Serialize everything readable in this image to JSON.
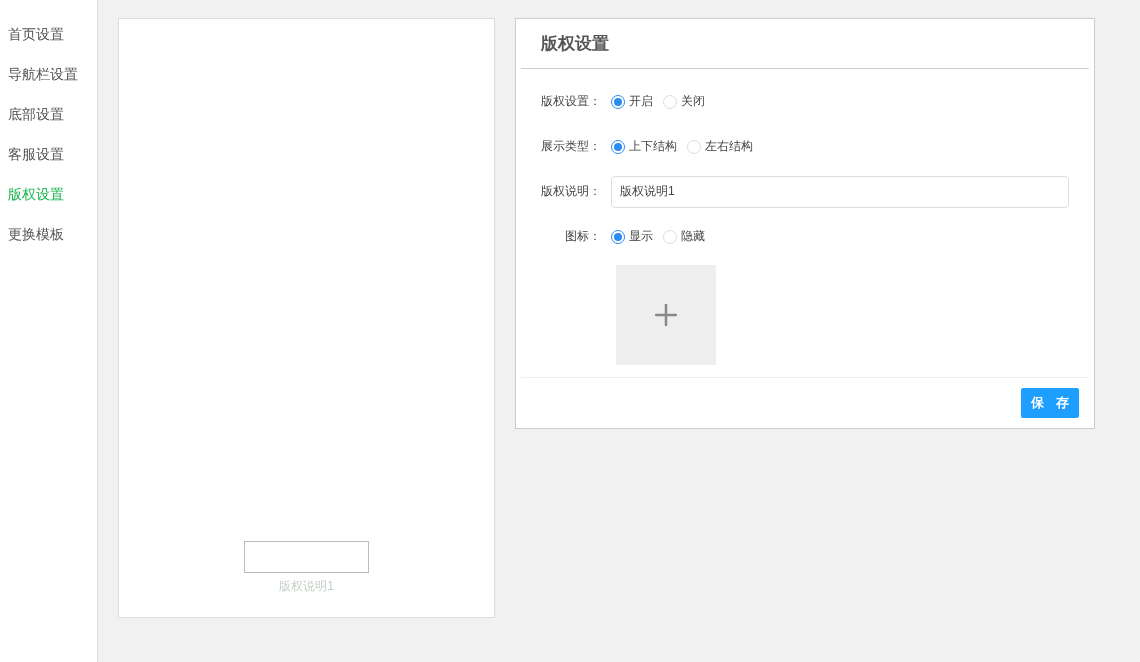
{
  "sidebar": {
    "items": [
      {
        "label": "首页设置",
        "selected": false
      },
      {
        "label": "导航栏设置",
        "selected": false
      },
      {
        "label": "底部设置",
        "selected": false
      },
      {
        "label": "客服设置",
        "selected": false
      },
      {
        "label": "版权设置",
        "selected": true
      },
      {
        "label": "更换模板",
        "selected": false
      }
    ]
  },
  "preview": {
    "caption": "版权说明1"
  },
  "panel": {
    "title": "版权设置",
    "fields": [
      {
        "kind": "radio",
        "label": "版权设置：",
        "options": [
          {
            "label": "开启",
            "selected": true
          },
          {
            "label": "关闭",
            "selected": false
          }
        ]
      },
      {
        "kind": "radio",
        "label": "展示类型：",
        "options": [
          {
            "label": "上下结构",
            "selected": true
          },
          {
            "label": "左右结构",
            "selected": false
          }
        ]
      },
      {
        "kind": "text",
        "label": "版权说明：",
        "value": "版权说明1"
      },
      {
        "kind": "radio",
        "label": "图标：",
        "options": [
          {
            "label": "显示",
            "selected": true
          },
          {
            "label": "隐藏",
            "selected": false
          }
        ]
      },
      {
        "kind": "upload"
      }
    ],
    "save_button": "保 存"
  }
}
